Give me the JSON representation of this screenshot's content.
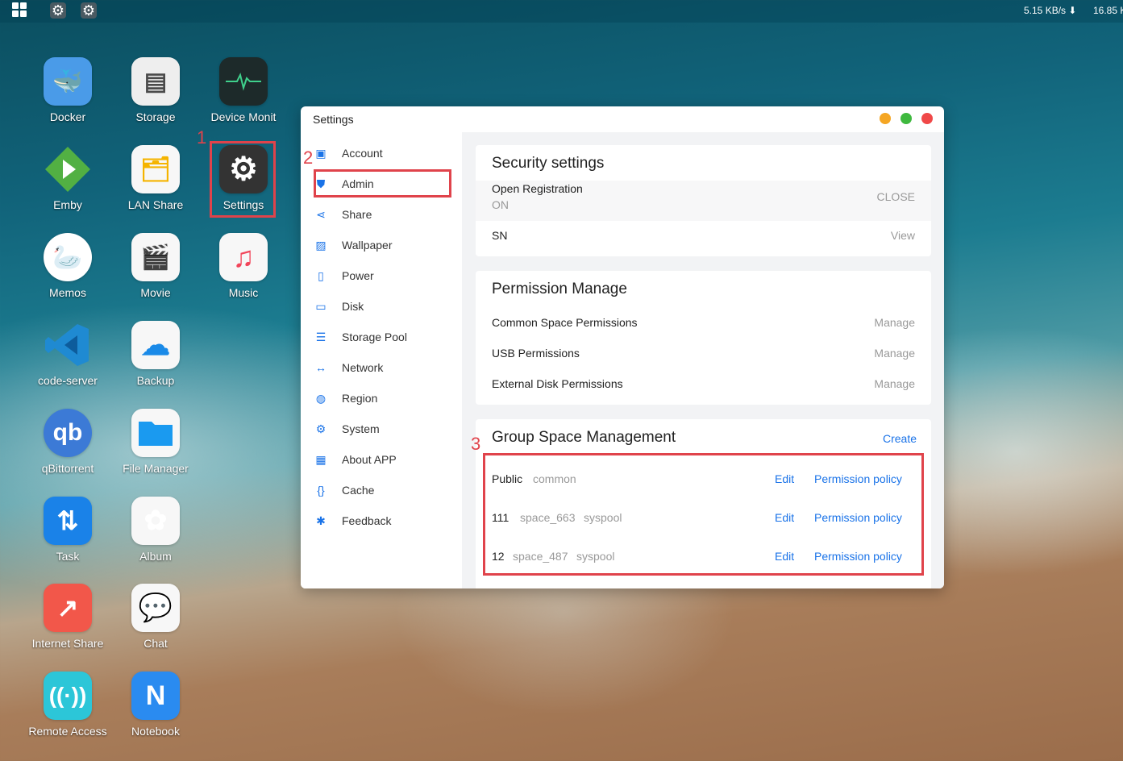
{
  "topbar": {
    "download_speed": "5.15 KB/s ⬇",
    "upload_speed": "16.85 K"
  },
  "desktop_apps": [
    {
      "label": "Docker",
      "icon": "docker-whale-icon",
      "color": "#4a9be8"
    },
    {
      "label": "Storage",
      "icon": "hard-drive-icon",
      "color": "#e9e9e9"
    },
    {
      "label": "Device Monit",
      "icon": "heartbeat-monitor-icon",
      "color": "#1d2a2a"
    },
    {
      "label": "Emby",
      "icon": "emby-play-icon",
      "color": "#52b043"
    },
    {
      "label": "LAN Share",
      "icon": "folder-network-icon",
      "color": "#f7f7f7"
    },
    {
      "label": "Settings",
      "icon": "gear-icon",
      "color": "#333333"
    },
    {
      "label": "Memos",
      "icon": "memos-goose-icon",
      "color": "#ffffff"
    },
    {
      "label": "Movie",
      "icon": "clapperboard-icon",
      "color": "#f7f7f7"
    },
    {
      "label": "Music",
      "icon": "music-note-icon",
      "color": "#f7f7f7"
    },
    {
      "label": "code-server",
      "icon": "vscode-icon",
      "color": "#1f8ad2"
    },
    {
      "label": "Backup",
      "icon": "cloud-backup-icon",
      "color": "#f7f7f7"
    },
    {
      "label": "qBittorrent",
      "icon": "qbittorrent-icon",
      "color": "#3c7ad6"
    },
    {
      "label": "File Manager",
      "icon": "folder-icon",
      "color": "#f7f7f7"
    },
    {
      "label": "Task",
      "icon": "transfer-arrows-icon",
      "color": "#1a82e8"
    },
    {
      "label": "Album",
      "icon": "photos-flower-icon",
      "color": "#f7f7f7"
    },
    {
      "label": "Internet Share",
      "icon": "share-arrow-icon",
      "color": "#f2574a"
    },
    {
      "label": "Chat",
      "icon": "chat-bubble-icon",
      "color": "#f7f7f7"
    },
    {
      "label": "Remote Access",
      "icon": "wireless-signal-icon",
      "color": "#2cc6d8"
    },
    {
      "label": "Notebook",
      "icon": "notebook-icon",
      "color": "#2a8bf0"
    }
  ],
  "annotations": {
    "step1": "1",
    "step2": "2",
    "step3": "3"
  },
  "window": {
    "title": "Settings",
    "controls": {
      "minimize_color": "#f5a623",
      "maximize_color": "#3fb93f",
      "close_color": "#f04848"
    }
  },
  "sidebar": {
    "items": [
      {
        "label": "Account",
        "icon": "user-card-icon"
      },
      {
        "label": "Admin",
        "icon": "admin-shield-icon"
      },
      {
        "label": "Share",
        "icon": "share-icon"
      },
      {
        "label": "Wallpaper",
        "icon": "image-icon"
      },
      {
        "label": "Power",
        "icon": "battery-icon"
      },
      {
        "label": "Disk",
        "icon": "disk-icon"
      },
      {
        "label": "Storage Pool",
        "icon": "database-icon"
      },
      {
        "label": "Network",
        "icon": "network-arrows-icon"
      },
      {
        "label": "Region",
        "icon": "globe-icon"
      },
      {
        "label": "System",
        "icon": "gear-icon"
      },
      {
        "label": "About APP",
        "icon": "grid-icon"
      },
      {
        "label": "Cache",
        "icon": "braces-icon"
      },
      {
        "label": "Feedback",
        "icon": "bug-icon"
      }
    ]
  },
  "security": {
    "title": "Security settings",
    "open_registration": {
      "label": "Open Registration",
      "value": "ON",
      "action": "CLOSE"
    },
    "sn": {
      "label": "SN",
      "action": "View"
    }
  },
  "permission": {
    "title": "Permission Manage",
    "rows": [
      {
        "label": "Common Space Permissions",
        "action": "Manage"
      },
      {
        "label": "USB Permissions",
        "action": "Manage"
      },
      {
        "label": "External Disk Permissions",
        "action": "Manage"
      }
    ]
  },
  "group_space": {
    "title": "Group Space Management",
    "create": "Create",
    "rows": [
      {
        "name": "Public",
        "space": "common",
        "pool": "",
        "edit": "Edit",
        "policy": "Permission policy"
      },
      {
        "name": "111",
        "space": "space_663",
        "pool": "syspool",
        "edit": "Edit",
        "policy": "Permission policy"
      },
      {
        "name": "12",
        "space": "space_487",
        "pool": "syspool",
        "edit": "Edit",
        "policy": "Permission policy"
      }
    ]
  }
}
